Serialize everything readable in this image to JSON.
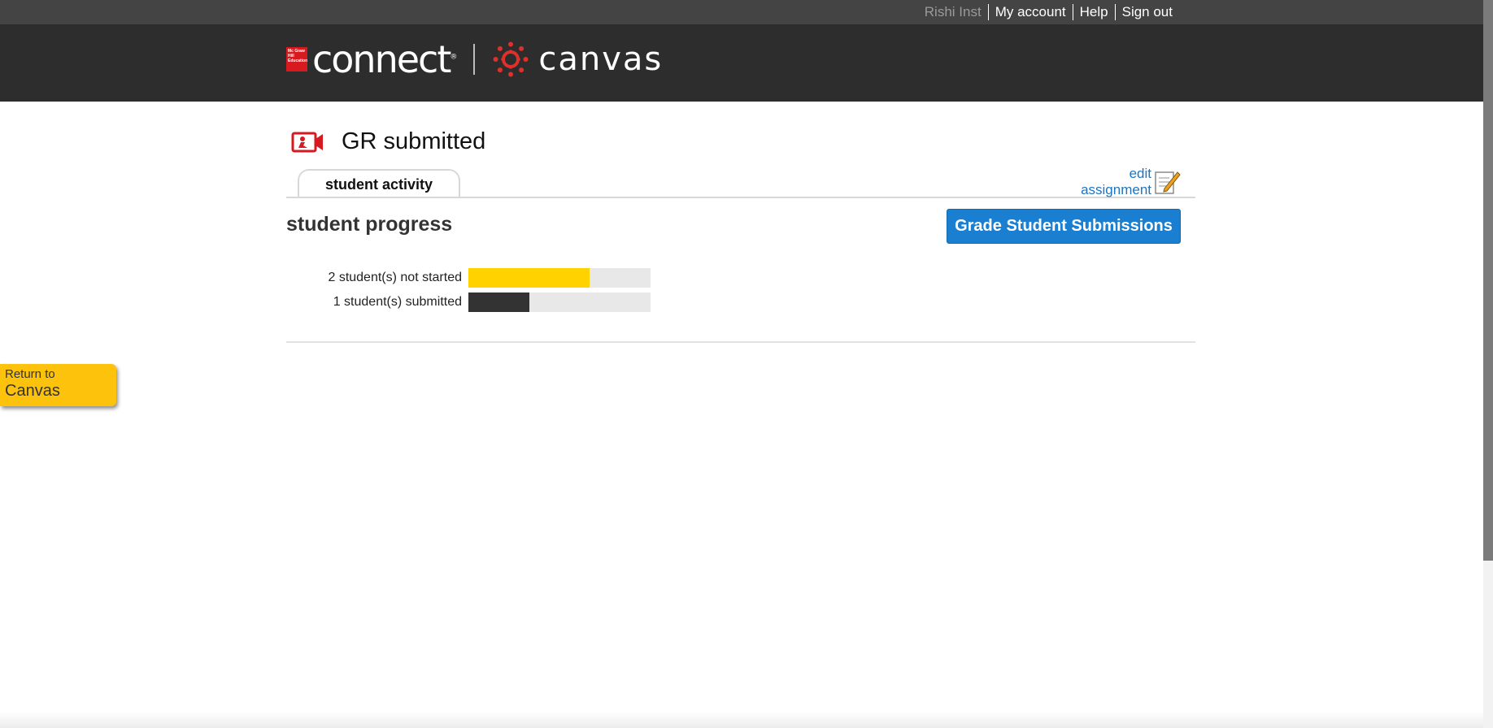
{
  "utility": {
    "user_name": "Rishi Inst",
    "my_account": "My account",
    "help": "Help",
    "sign_out": "Sign out"
  },
  "header": {
    "connect_brand": "connect",
    "connect_mark": "®",
    "mh_logo_text": "Mc Graw Hill Education",
    "canvas_brand": "canvas"
  },
  "assignment": {
    "title": "GR submitted",
    "edit_line1": "edit",
    "edit_line2": "assignment"
  },
  "tabs": [
    {
      "label": "student activity",
      "active": true
    }
  ],
  "progress": {
    "section_title": "student progress",
    "grade_button": "Grade Student Submissions",
    "rows": [
      {
        "label": "2 student(s) not started",
        "fraction": 0.667,
        "color": "#ffd200"
      },
      {
        "label": "1 student(s) submitted",
        "fraction": 0.333,
        "color": "#333333"
      }
    ]
  },
  "return_tab": {
    "line1": "Return to",
    "line2": "Canvas"
  },
  "colors": {
    "accent_blue": "#1a7fd1",
    "return_yellow": "#fdc20b",
    "header_dark": "#2d2d2d"
  }
}
